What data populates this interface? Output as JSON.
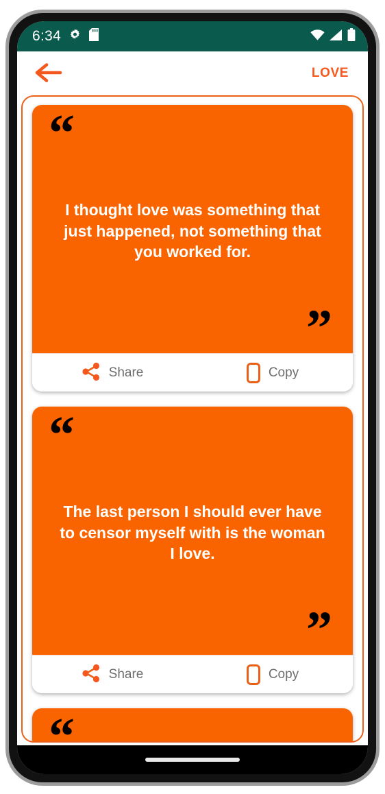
{
  "status_bar": {
    "time": "6:34",
    "icons_left": [
      "settings-gear-icon",
      "sd-card-icon"
    ],
    "icons_right": [
      "wifi-icon",
      "cellular-signal-icon",
      "battery-icon"
    ],
    "background_color": "#0b5a4e"
  },
  "app_bar": {
    "back_icon": "back-arrow-icon",
    "title": "LOVE",
    "accent_color": "#f4581f"
  },
  "theme": {
    "card_orange": "#fa6400",
    "border_orange": "#ea6018",
    "label_gray": "#6d6d6d"
  },
  "actions": {
    "share_label": "Share",
    "share_icon": "share-icon",
    "copy_label": "Copy",
    "copy_icon": "copy-icon"
  },
  "quote_marks": {
    "open": "“",
    "close": "”"
  },
  "cards": [
    {
      "text": "I thought love was something that just happened, not something that you worked for."
    },
    {
      "text": "The last person I should ever have to censor myself with is the woman I love."
    },
    {
      "text": ""
    }
  ],
  "nav_bar": {
    "gesture_pill": "home-gesture-pill"
  }
}
